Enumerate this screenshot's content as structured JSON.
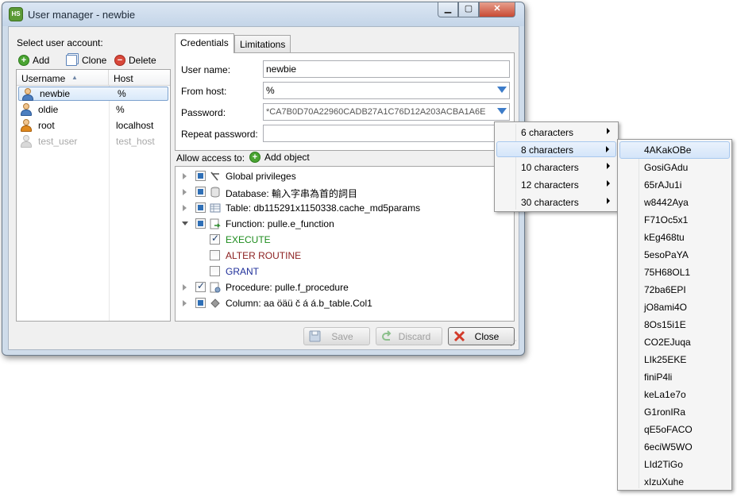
{
  "window": {
    "title": "User manager - newbie",
    "app_icon": "HS"
  },
  "left": {
    "select_label": "Select user account:",
    "toolbar": {
      "add": "Add",
      "clone": "Clone",
      "delete": "Delete"
    },
    "columns": {
      "username": "Username",
      "host": "Host"
    },
    "users": [
      {
        "name": "newbie",
        "host": "%"
      },
      {
        "name": "oldie",
        "host": "%"
      },
      {
        "name": "root",
        "host": "localhost"
      },
      {
        "name": "test_user",
        "host": "test_host"
      }
    ]
  },
  "tabs": {
    "credentials": "Credentials",
    "limitations": "Limitations"
  },
  "credentials": {
    "username_label": "User name:",
    "username_value": "newbie",
    "fromhost_label": "From host:",
    "fromhost_value": "%",
    "password_label": "Password:",
    "password_value": "*CA7B0D70A22960CADB27A1C76D12A203ACBA1A6E",
    "repeat_label": "Repeat password:",
    "repeat_value": ""
  },
  "access": {
    "label": "Allow access to:",
    "add_object": "Add object",
    "items": [
      "Global privileges",
      "Database: 輸入字串為首的詞目",
      "Table: db115291x1150338.cache_md5params",
      "Function: pulle.e_function",
      "EXECUTE",
      "ALTER ROUTINE",
      "GRANT",
      "Procedure: pulle.f_procedure",
      "Column: aa öäü č á á.b_table.Col1"
    ]
  },
  "buttons": {
    "save": "Save",
    "discard": "Discard",
    "close": "Close"
  },
  "menu_lengths": [
    "6 characters",
    "8 characters",
    "10 characters",
    "12 characters",
    "30 characters"
  ],
  "generated_passwords": [
    "4AKakOBe",
    "GosiGAdu",
    "65rAJu1i",
    "w8442Aya",
    "F71Oc5x1",
    "kEg468tu",
    "5esoPaYA",
    "75H68OL1",
    "72ba6EPI",
    "jO8ami4O",
    "8Os15i1E",
    "CO2EJuqa",
    "LIk25EKE",
    "finiP4li",
    "keLa1e7o",
    "G1ronIRa",
    "qE5oFACO",
    "6eciW5WO",
    "LId2TiGo",
    "xIzuXuhe"
  ],
  "colors": {
    "execute": "#1d8c1d",
    "alter_routine": "#8b1e1e",
    "grant": "#1f2f9a",
    "selection": "#d9e9fa"
  }
}
